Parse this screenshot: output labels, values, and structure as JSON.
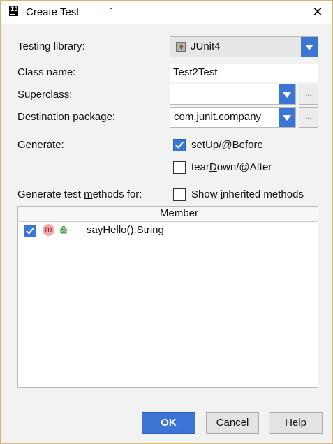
{
  "window": {
    "title": "Create Test",
    "close_glyph": "✕"
  },
  "form": {
    "testing_library_label": "Testing library:",
    "testing_library_value": "JUnit4",
    "class_name_label": "Class name:",
    "class_name_value": "Test2Test",
    "superclass_label": "Superclass:",
    "superclass_value": "",
    "destination_label": "Destination package:",
    "destination_value": "com.junit.company",
    "browse_glyph": "...",
    "generate_label": "Generate:",
    "setup_label_pre": "set",
    "setup_label_u": "U",
    "setup_label_post": "p/@Before",
    "setup_checked": true,
    "teardown_label_pre": "tear",
    "teardown_label_u": "D",
    "teardown_label_post": "own/@After",
    "teardown_checked": false,
    "methods_label_pre": "Generate test ",
    "methods_label_u": "m",
    "methods_label_post": "ethods for:",
    "inherited_label_pre": "Show ",
    "inherited_label_u": "i",
    "inherited_label_post": "nherited methods",
    "inherited_checked": false
  },
  "table": {
    "header_member": "Member",
    "rows": [
      {
        "checked": true,
        "icon_letter": "m",
        "name": "sayHello():String"
      }
    ]
  },
  "buttons": {
    "ok": "OK",
    "cancel": "Cancel",
    "help": "Help"
  },
  "colors": {
    "accent": "#3b76d6",
    "method_icon": "#f2a8ae"
  },
  "icons": {
    "app": "intellij-icon",
    "junit": "junit-icon",
    "method": "method-icon",
    "lock": "public-lock-icon"
  }
}
